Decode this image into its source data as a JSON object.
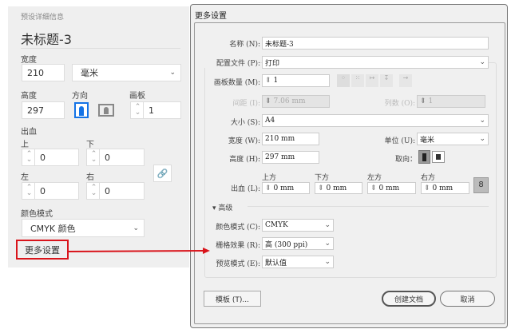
{
  "left_panel": {
    "section_title": "预设详细信息",
    "doc_name": "未标题-3",
    "width_label": "宽度",
    "width_value": "210",
    "unit": "毫米",
    "height_label": "高度",
    "height_value": "297",
    "orientation_label": "方向",
    "artboards_label": "画板",
    "artboards_value": "1",
    "bleed_label": "出血",
    "top_label": "上",
    "top_value": "0",
    "bottom_label": "下",
    "bottom_value": "0",
    "left_label": "左",
    "left_value": "0",
    "right_label": "右",
    "right_value": "0",
    "color_mode_label": "颜色模式",
    "color_mode": "CMYK 颜色",
    "more_settings": "更多设置"
  },
  "dialog": {
    "title": "更多设置",
    "name_label": "名称 (N):",
    "name_value": "未标题-3",
    "profile_label": "配置文件 (P):",
    "profile_value": "打印",
    "artboards_label": "画板数量 (M):",
    "artboards_value": "1",
    "spacing_label": "间距 (I):",
    "spacing_value": "7.06 mm",
    "columns_label": "列数 (O):",
    "columns_value": "1",
    "size_label": "大小 (S):",
    "size_value": "A4",
    "width_label": "宽度 (W):",
    "width_value": "210 mm",
    "unit_label": "单位 (U):",
    "unit_value": "毫米",
    "height_label": "高度 (H):",
    "height_value": "297 mm",
    "orientation_label": "取向：",
    "bleed_label": "出血 (L):",
    "bleed": [
      {
        "label": "上方",
        "value": "0 mm"
      },
      {
        "label": "下方",
        "value": "0 mm"
      },
      {
        "label": "左方",
        "value": "0 mm"
      },
      {
        "label": "右方",
        "value": "0 mm"
      }
    ],
    "advanced_label": "高级",
    "color_mode_label": "颜色模式 (C):",
    "color_mode_value": "CMYK",
    "raster_label": "栅格效果 (R):",
    "raster_value": "高 (300 ppi)",
    "preview_label": "预览模式 (E):",
    "preview_value": "默认值",
    "template_button": "模板 (T)...",
    "create_button": "创建文档",
    "cancel_button": "取消"
  },
  "colors": {
    "accent": "#1473e6",
    "highlight": "#d9141b"
  }
}
